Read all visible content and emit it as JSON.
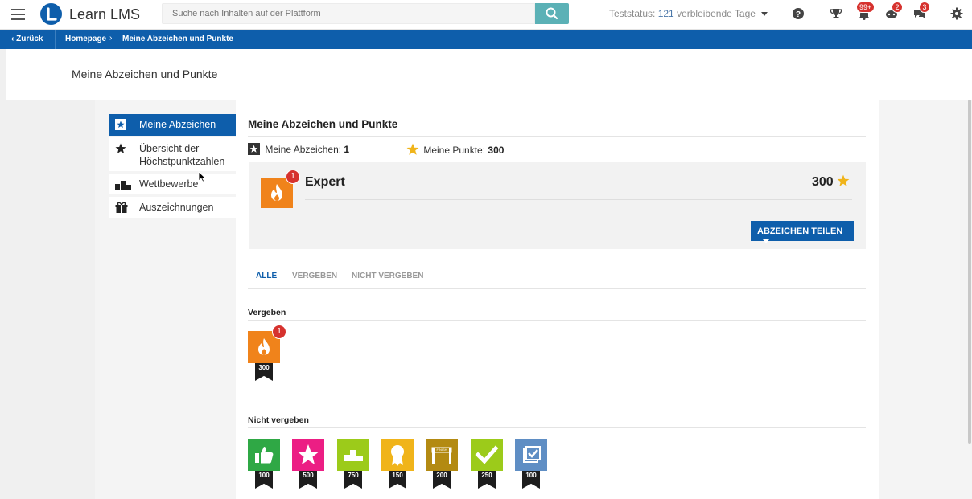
{
  "header": {
    "brand": "Learn LMS",
    "search_placeholder": "Suche nach Inhalten auf der Plattform",
    "trial_label": "Teststatus:",
    "trial_days": "121",
    "trial_suffix": "verbleibende Tage",
    "notifications_badge": "99+",
    "social_badge": "2",
    "messages_badge": "3"
  },
  "breadcrumb": {
    "back_label": "Zurück",
    "home": "Homepage",
    "current": "Meine Abzeichen und Punkte"
  },
  "page_title": "Meine Abzeichen und Punkte",
  "sidebar": {
    "items": [
      {
        "label": "Meine Abzeichen",
        "icon": "star-square-icon",
        "active": true
      },
      {
        "label": "Übersicht der Höchstpunktzahlen",
        "icon": "star-icon",
        "active": false
      },
      {
        "label": "Wettbewerbe",
        "icon": "podium-icon",
        "active": false
      },
      {
        "label": "Auszeichnungen",
        "icon": "gift-icon",
        "active": false
      }
    ]
  },
  "main": {
    "title": "Meine Abzeichen und Punkte",
    "badges_label": "Meine Abzeichen:",
    "badges_count": "1",
    "points_label": "Meine Punkte:",
    "points_count": "300",
    "featured": {
      "name": "Expert",
      "points": "300",
      "count_badge": "1",
      "color": "#f0831b",
      "icon": "flame-icon"
    },
    "share_button": "ABZEICHEN TEILEN",
    "tabs": [
      "ALLE",
      "VERGEBEN",
      "NICHT VERGEBEN"
    ],
    "awarded_label": "Vergeben",
    "awarded": [
      {
        "points": "300",
        "color": "#f0831b",
        "icon": "flame-icon",
        "count": "1"
      }
    ],
    "not_awarded_label": "Nicht vergeben",
    "not_awarded": [
      {
        "points": "100",
        "color": "#2fa845",
        "icon": "thumbs-up-icon"
      },
      {
        "points": "500",
        "color": "#ec1e84",
        "icon": "star-icon"
      },
      {
        "points": "750",
        "color": "#9ccb1a",
        "icon": "podium-icon"
      },
      {
        "points": "150",
        "color": "#f0b41a",
        "icon": "medal-icon"
      },
      {
        "points": "200",
        "color": "#b38a12",
        "icon": "finish-line-icon",
        "label": "FINISH"
      },
      {
        "points": "250",
        "color": "#9ccb1a",
        "icon": "check-icon"
      },
      {
        "points": "100",
        "color": "#5f8ec4",
        "icon": "checklist-icon"
      }
    ]
  }
}
